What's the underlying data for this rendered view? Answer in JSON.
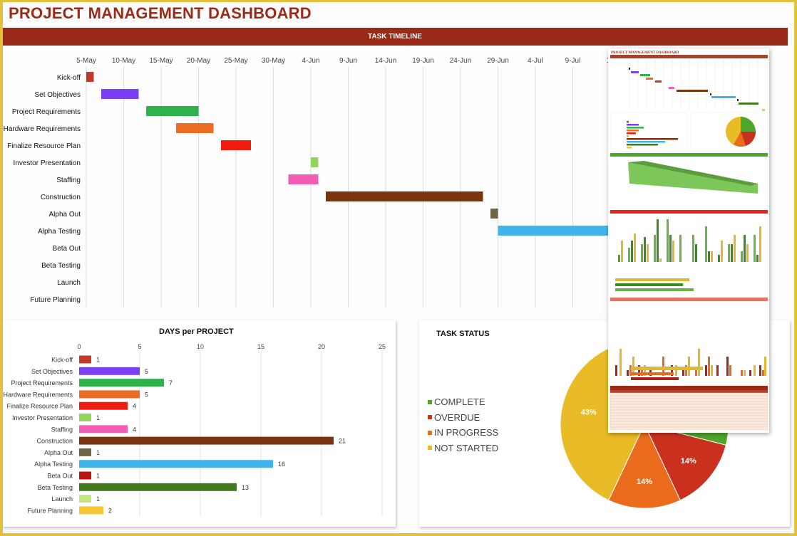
{
  "title": "PROJECT MANAGEMENT DASHBOARD",
  "timeline": {
    "band_label": "TASK TIMELINE",
    "date_ticks": [
      "5-May",
      "10-May",
      "15-May",
      "20-May",
      "25-May",
      "30-May",
      "4-Jun",
      "9-Jun",
      "14-Jun",
      "19-Jun",
      "24-Jun",
      "29-Jun",
      "4-Jul",
      "9-Jul",
      "14"
    ]
  },
  "colors": {
    "brand_red": "#9a2a18",
    "frame_gold": "#e2c13c"
  },
  "chart_data": [
    {
      "type": "gantt",
      "title": "TASK TIMELINE",
      "x_unit": "day offset from 5-May",
      "tasks": [
        {
          "name": "Kick-off",
          "start": 0,
          "days": 1,
          "color": "#c0392b"
        },
        {
          "name": "Set Objectives",
          "start": 2,
          "days": 5,
          "color": "#7b3ff2"
        },
        {
          "name": "Project Requirements",
          "start": 8,
          "days": 7,
          "color": "#2db34a"
        },
        {
          "name": "Hardware Requirements",
          "start": 12,
          "days": 5,
          "color": "#ea6c25"
        },
        {
          "name": "Finalize Resource Plan",
          "start": 18,
          "days": 4,
          "color": "#f21b0f"
        },
        {
          "name": "Investor Presentation",
          "start": 30,
          "days": 1,
          "color": "#94d35a"
        },
        {
          "name": "Staffing",
          "start": 27,
          "days": 4,
          "color": "#f45db4"
        },
        {
          "name": "Construction",
          "start": 32,
          "days": 21,
          "color": "#7a3510"
        },
        {
          "name": "Alpha Out",
          "start": 54,
          "days": 1,
          "color": "#6e6446"
        },
        {
          "name": "Alpha Testing",
          "start": 55,
          "days": 16,
          "color": "#42b4ec"
        },
        {
          "name": "Beta Out",
          "start": null,
          "days": 1,
          "color": "#b8180f"
        },
        {
          "name": "Beta Testing",
          "start": null,
          "days": 13,
          "color": "#447a1e"
        },
        {
          "name": "Launch",
          "start": null,
          "days": 1,
          "color": "#c6e57a"
        },
        {
          "name": "Future Planning",
          "start": null,
          "days": 2,
          "color": "#f7c530"
        }
      ],
      "x_ticks_days": [
        0,
        5,
        10,
        15,
        20,
        25,
        30,
        35,
        40,
        45,
        50,
        55,
        60,
        65,
        70
      ]
    },
    {
      "type": "bar",
      "orientation": "horizontal",
      "title": "DAYS per PROJECT",
      "categories": [
        "Kick-off",
        "Set Objectives",
        "Project Requirements",
        "Hardware Requirements",
        "Finalize Resource Plan",
        "Investor Presentation",
        "Staffing",
        "Construction",
        "Alpha Out",
        "Alpha Testing",
        "Beta Out",
        "Beta Testing",
        "Launch",
        "Future Planning"
      ],
      "values": [
        1,
        5,
        7,
        5,
        4,
        1,
        4,
        21,
        1,
        16,
        1,
        13,
        1,
        2
      ],
      "colors": [
        "#c0392b",
        "#7b3ff2",
        "#2db34a",
        "#ea6c25",
        "#f21b0f",
        "#94d35a",
        "#f45db4",
        "#7a3510",
        "#6e6446",
        "#42b4ec",
        "#b8180f",
        "#447a1e",
        "#c6e57a",
        "#f7c530"
      ],
      "xlim": [
        0,
        25
      ],
      "x_ticks": [
        "0",
        "5",
        "10",
        "15",
        "20",
        "25"
      ],
      "grid": true
    },
    {
      "type": "pie",
      "title": "TASK STATUS",
      "legend_position": "left",
      "slices": [
        {
          "label": "COMPLETE",
          "value": 29,
          "display": "",
          "color": "#4ea72a"
        },
        {
          "label": "OVERDUE",
          "value": 14,
          "display": "14%",
          "color": "#c9311e"
        },
        {
          "label": "IN PROGRESS",
          "value": 14,
          "display": "14%",
          "color": "#ea6b1c"
        },
        {
          "label": "NOT STARTED",
          "value": 43,
          "display": "43%",
          "color": "#e9bb26"
        }
      ]
    }
  ],
  "inset": {
    "description": "thumbnail preview of full dashboard"
  }
}
